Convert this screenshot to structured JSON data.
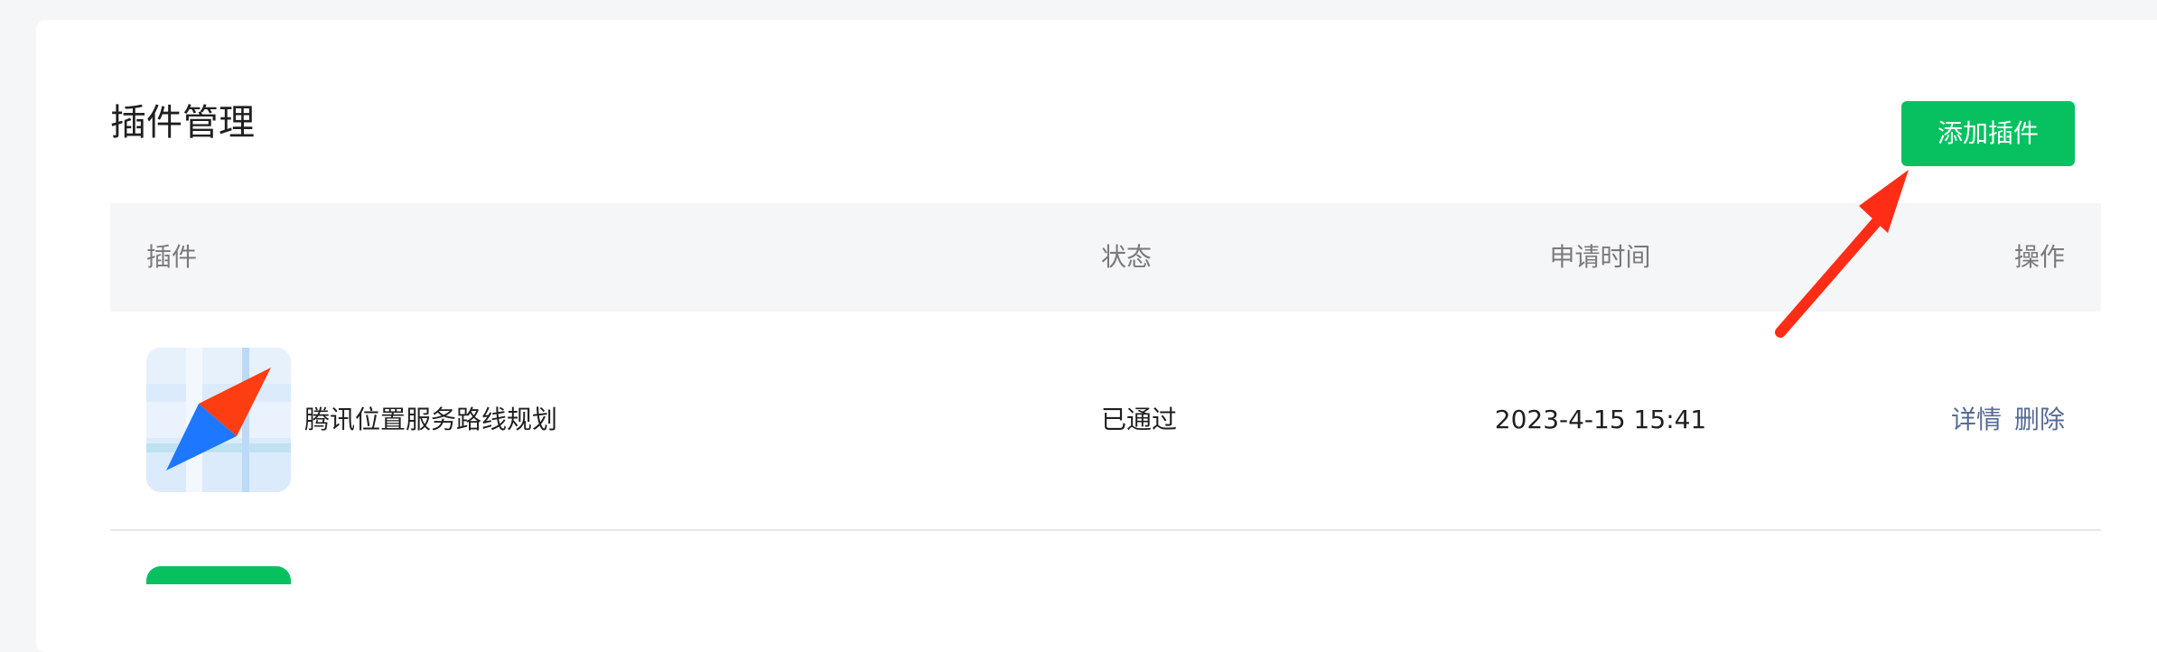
{
  "page": {
    "title": "插件管理",
    "add_button_label": "添加插件"
  },
  "table": {
    "columns": [
      "插件",
      "状态",
      "申请时间",
      "操作"
    ],
    "rows": [
      {
        "name": "腾讯位置服务路线规划",
        "status": "已通过",
        "time": "2023-4-15 15:41",
        "actions": [
          "详情",
          "删除"
        ]
      }
    ]
  },
  "colors": {
    "accent": "#07c160",
    "link": "#576b95",
    "header_bg": "#f5f6f7",
    "annotation": "#ff2d16"
  },
  "icons": {
    "plugin_icon": "map-compass-icon",
    "annotation": "red-arrow-annotation"
  }
}
